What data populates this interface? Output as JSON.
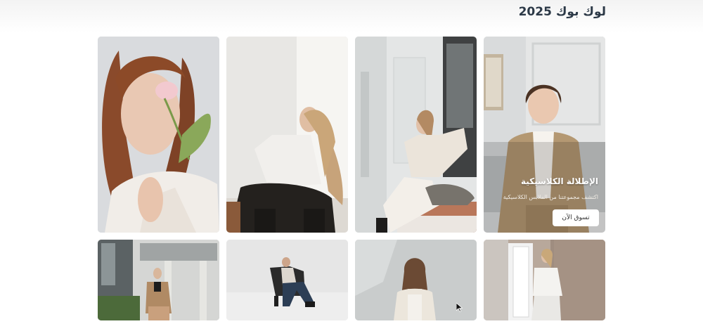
{
  "page": {
    "title": "لوك بوك 2025"
  },
  "featured": {
    "title": "الإطلالة الكلاسيكية",
    "subtitle": "اكتشف مجموعتنا من الملابس الكلاسيكية",
    "button_label": "تسوق الآن"
  },
  "gallery": {
    "photos": [
      {
        "id": "1",
        "subject": "curly red-haired woman holding pink tulip"
      },
      {
        "id": "2",
        "subject": "woman in white shirt sitting on chair"
      },
      {
        "id": "3",
        "subject": "woman sitting on windowsill in beige outfit"
      },
      {
        "id": "4",
        "subject": "woman in beige blazer, featured collection"
      },
      {
        "id": "5",
        "subject": "woman in blazer outside building"
      },
      {
        "id": "6",
        "subject": "woman sitting in black chair in studio"
      },
      {
        "id": "7",
        "subject": "woman in cream jacket against grey wall"
      },
      {
        "id": "8",
        "subject": "woman in white outfit by window"
      }
    ]
  },
  "colors": {
    "title_text": "#2c3947",
    "button_bg": "#ffffff",
    "overlay_text": "#ffffff"
  }
}
